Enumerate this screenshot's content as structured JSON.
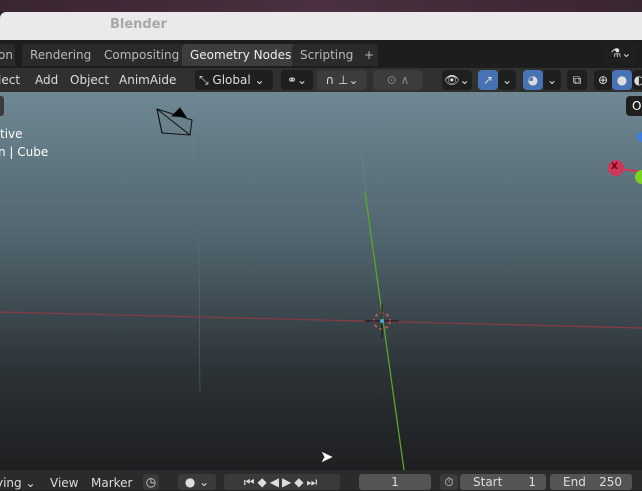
{
  "window": {
    "title": "Blender"
  },
  "workspace_tabs": [
    {
      "label": "on"
    },
    {
      "label": "Rendering"
    },
    {
      "label": "Compositing"
    },
    {
      "label": "Geometry Nodes",
      "active": true
    },
    {
      "label": "Scripting"
    },
    {
      "label": "+"
    }
  ],
  "header": {
    "menus": [
      "lect",
      "Add",
      "Object",
      "AnimAide"
    ],
    "orientation": "Global"
  },
  "viewport": {
    "overlay_line1": "tive",
    "overlay_line2": "n | Cube",
    "gizmo_x_label": "X",
    "corner_button": "O"
  },
  "timeline": {
    "playback": "ying",
    "view": "View",
    "marker": "Marker",
    "current_frame": "1",
    "start_label": "Start",
    "start": "1",
    "end_label": "End",
    "end": "250"
  },
  "colors": {
    "accent": "#4772b3",
    "x_axis": "#d0365a",
    "y_axis": "#7ad321"
  }
}
